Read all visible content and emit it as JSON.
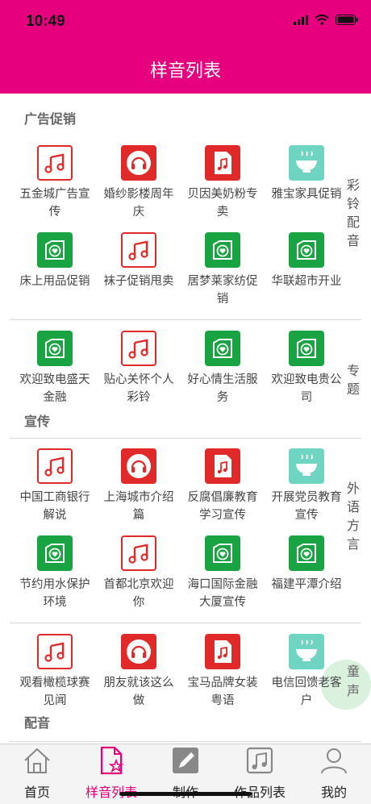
{
  "status": {
    "time": "10:49"
  },
  "header": {
    "title": "样音列表"
  },
  "colors": {
    "brand": "#e6007e",
    "icon_red": "#e02a2a",
    "icon_green": "#19a342",
    "icon_teal": "#6fd4c2"
  },
  "sections": [
    {
      "title": "广告促销",
      "items": [
        {
          "label": "五金城广告宣传",
          "icon": "music-icon"
        },
        {
          "label": "婚纱影楼周年庆",
          "icon": "headphones-icon"
        },
        {
          "label": "贝因美奶粉专卖",
          "icon": "music-file-icon"
        },
        {
          "label": "雅宝家具促销",
          "icon": "bowl-icon"
        },
        {
          "label": "床上用品促销",
          "icon": "heart-card-icon"
        },
        {
          "label": "袜子促销甩卖",
          "icon": "music-icon"
        },
        {
          "label": "居梦莱家纺促销",
          "icon": "heart-card-icon"
        },
        {
          "label": "华联超市开业",
          "icon": "heart-card-icon"
        }
      ]
    },
    {
      "title": "宣传",
      "items": [
        {
          "label": "欢迎致电盛天金融",
          "icon": "heart-card-icon"
        },
        {
          "label": "贴心关怀个人彩铃",
          "icon": "music-icon"
        },
        {
          "label": "好心情生活服务",
          "icon": "heart-card-icon"
        },
        {
          "label": "欢迎致电贵公司",
          "icon": "heart-card-icon"
        }
      ]
    },
    {
      "title": "",
      "items": [
        {
          "label": "中国工商银行解说",
          "icon": "music-icon"
        },
        {
          "label": "上海城市介绍篇",
          "icon": "headphones-icon"
        },
        {
          "label": "反腐倡廉教育学习宣传",
          "icon": "music-file-icon"
        },
        {
          "label": "开展党员教育宣传",
          "icon": "bowl-icon"
        },
        {
          "label": "节约用水保护环境",
          "icon": "heart-card-icon"
        },
        {
          "label": "首都北京欢迎你",
          "icon": "music-icon"
        },
        {
          "label": "海口国际金融大厦宣传",
          "icon": "heart-card-icon"
        },
        {
          "label": "福建平潭介绍",
          "icon": "heart-card-icon"
        }
      ]
    },
    {
      "title": "配音",
      "items": [
        {
          "label": "观看橄榄球赛见闻",
          "icon": "music-icon"
        },
        {
          "label": "朋友就该这么做",
          "icon": "headphones-icon"
        },
        {
          "label": "宝马品牌女装粤语",
          "icon": "music-file-icon"
        },
        {
          "label": "电信回馈老客户",
          "icon": "bowl-icon"
        }
      ]
    }
  ],
  "side_labels": [
    "彩铃配音",
    "专题",
    "外语方言",
    "童声"
  ],
  "tabs": [
    {
      "label": "首页",
      "icon": "home-icon"
    },
    {
      "label": "样音列表",
      "icon": "list-star-icon",
      "active": true
    },
    {
      "label": "制作",
      "icon": "edit-icon"
    },
    {
      "label": "作品列表",
      "icon": "works-icon"
    },
    {
      "label": "我的",
      "icon": "user-icon"
    }
  ]
}
